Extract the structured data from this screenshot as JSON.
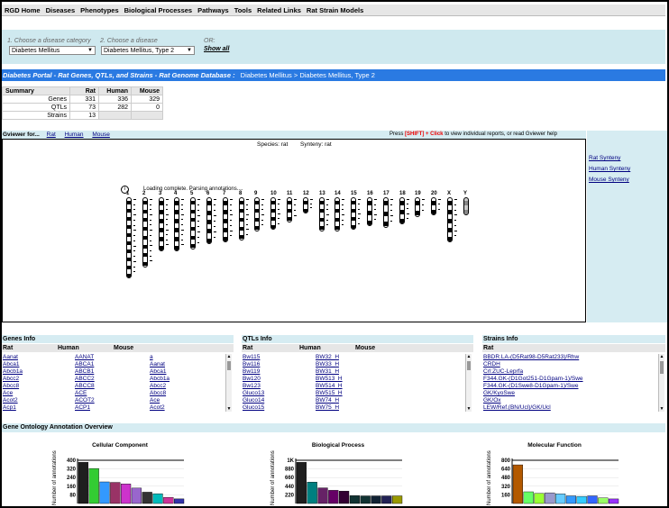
{
  "nav": [
    "RGD Home",
    "Diseases",
    "Phenotypes",
    "Biological Processes",
    "Pathways",
    "Tools",
    "Related Links",
    "Rat Strain Models"
  ],
  "chooser": {
    "step1_label": "1. Choose a disease category",
    "step1_value": "Diabetes Mellitus",
    "step2_label": "2. Choose a disease",
    "step2_value": "Diabetes Mellitus, Type 2",
    "or_label": "OR:",
    "show_all": "Show all"
  },
  "portal": {
    "title": "Diabetes Portal - Rat Genes, QTLs, and Strains - Rat Genome Database :",
    "crumb": "Diabetes Mellitus > Diabetes Mellitus, Type 2"
  },
  "summary": {
    "header": [
      "Summary",
      "Rat",
      "Human",
      "Mouse"
    ],
    "rows": [
      {
        "label": "Genes",
        "rat": "331",
        "human": "336",
        "mouse": "329"
      },
      {
        "label": "QTLs",
        "rat": "73",
        "human": "282",
        "mouse": "0"
      },
      {
        "label": "Strains",
        "rat": "13",
        "human": "",
        "mouse": ""
      }
    ]
  },
  "gviewer": {
    "label": "Gviewer for...",
    "links": [
      "Rat",
      "Human",
      "Mouse"
    ],
    "hint_pre": "Press",
    "hint_key": "[SHIFT] + Click",
    "hint_post": "to view individual reports, or read Gviewer help",
    "species": "Species: rat",
    "synteny": "Synteny: rat",
    "loading": "Loading complete. Parsing annotations....",
    "info_icon": "i",
    "chromosomes": [
      "1",
      "2",
      "3",
      "4",
      "5",
      "6",
      "7",
      "8",
      "9",
      "10",
      "11",
      "12",
      "13",
      "14",
      "15",
      "16",
      "17",
      "18",
      "19",
      "20",
      "X",
      "Y"
    ],
    "side_links": [
      "Rat Synteny",
      "Human Synteny",
      "Mouse Synteny"
    ]
  },
  "genes": {
    "title": "Genes Info",
    "cols": [
      "Rat",
      "Human",
      "Mouse"
    ],
    "rows": [
      [
        "Aanat",
        "AANAT",
        "a"
      ],
      [
        "Abca1",
        "ABCA1",
        "Aanat"
      ],
      [
        "Abcb1a",
        "ABCB1",
        "Abca1"
      ],
      [
        "Abcc2",
        "ABCC2",
        "Abcb1a"
      ],
      [
        "Abcc8",
        "ABCC8",
        "Abcc2"
      ],
      [
        "Ace",
        "ACE",
        "Abcc8"
      ],
      [
        "Acot2",
        "ACOT2",
        "Ace"
      ],
      [
        "Acp1",
        "ACP1",
        "Acot2"
      ]
    ]
  },
  "qtls": {
    "title": "QTLs Info",
    "cols": [
      "Rat",
      "Human",
      "Mouse"
    ],
    "rows": [
      [
        "Bw115",
        "BW32_H",
        ""
      ],
      [
        "Bw116",
        "BW33_H",
        ""
      ],
      [
        "Bw119",
        "BW31_H",
        ""
      ],
      [
        "Bw120",
        "BW513_H",
        ""
      ],
      [
        "Bw123",
        "BW514_H",
        ""
      ],
      [
        "Gluco13",
        "BW515_H",
        ""
      ],
      [
        "Gluco14",
        "BW74_H",
        ""
      ],
      [
        "Gluco15",
        "BW75_H",
        ""
      ]
    ]
  },
  "strains": {
    "title": "Strains Info",
    "cols": [
      "Rat"
    ],
    "rows": [
      "BBDR.LA-(D5Rat98-D5Rat233)/Rhw",
      "CRDH",
      "Crl:ZUC-Leprfa",
      "F344.GK-(D1Got251-D1Gpam-1)/Swe",
      "F344.GK-(D1Swe8-D1Gpam-1)/Swe",
      "GK/KyoSwe",
      "GK/Ox",
      "LEW/Ref.(BN/Ucl)/GK/Ucl"
    ]
  },
  "go": {
    "title": "Gene Ontology Annotation Overview",
    "ylabel": "Number of annotations",
    "charts": [
      {
        "title": "Cellular Component",
        "ticks": [
          "400",
          "320",
          "240",
          "160",
          "80"
        ],
        "ymax": 420,
        "values": [
          400,
          340,
          210,
          205,
          190,
          150,
          110,
          95,
          60,
          45
        ],
        "colors": [
          "#1f1f1f",
          "#33cc33",
          "#3399ff",
          "#993366",
          "#cc33cc",
          "#9966cc",
          "#333333",
          "#00bbbb",
          "#cc3399",
          "#3333aa"
        ]
      },
      {
        "title": "Biological Process",
        "ticks": [
          "1K",
          "880",
          "660",
          "440",
          "220"
        ],
        "ymax": 1050,
        "values": [
          1000,
          520,
          380,
          320,
          300,
          190,
          185,
          185,
          185,
          185
        ],
        "colors": [
          "#1f1f1f",
          "#008080",
          "#662266",
          "#660066",
          "#330033",
          "#113333",
          "#113333",
          "#112233",
          "#222255",
          "#999900"
        ]
      },
      {
        "title": "Molecular Function",
        "ticks": [
          "800",
          "640",
          "480",
          "320",
          "160"
        ],
        "ymax": 850,
        "values": [
          760,
          230,
          200,
          210,
          190,
          150,
          140,
          150,
          110,
          90
        ],
        "colors": [
          "#b35900",
          "#66ff66",
          "#99ff33",
          "#9999cc",
          "#66ccff",
          "#3399ff",
          "#33ccff",
          "#3366ff",
          "#99ff66",
          "#9933ff"
        ]
      }
    ]
  }
}
